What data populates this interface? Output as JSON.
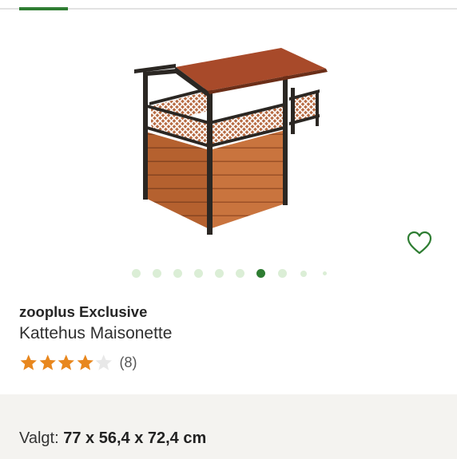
{
  "top_tab": {
    "active": true
  },
  "product": {
    "image_name": "cat-house-maisonette-image",
    "brand": "zooplus Exclusive",
    "name": "Kattehus Maisonette"
  },
  "wishlist": {
    "icon": "heart-outline-icon"
  },
  "carousel": {
    "total_dots": 10,
    "active_index": 6
  },
  "rating": {
    "stars_filled": 4,
    "stars_total": 5,
    "count_label": "(8)"
  },
  "variant": {
    "label": "Valgt:",
    "value": "77 x 56,4 x 72,4 cm"
  },
  "colors": {
    "accent_green": "#2e7d32",
    "dot_inactive": "#dbeed6",
    "star_filled": "#e8871e",
    "star_empty": "#e8e8e8",
    "panel_bg": "#f4f3f0"
  }
}
